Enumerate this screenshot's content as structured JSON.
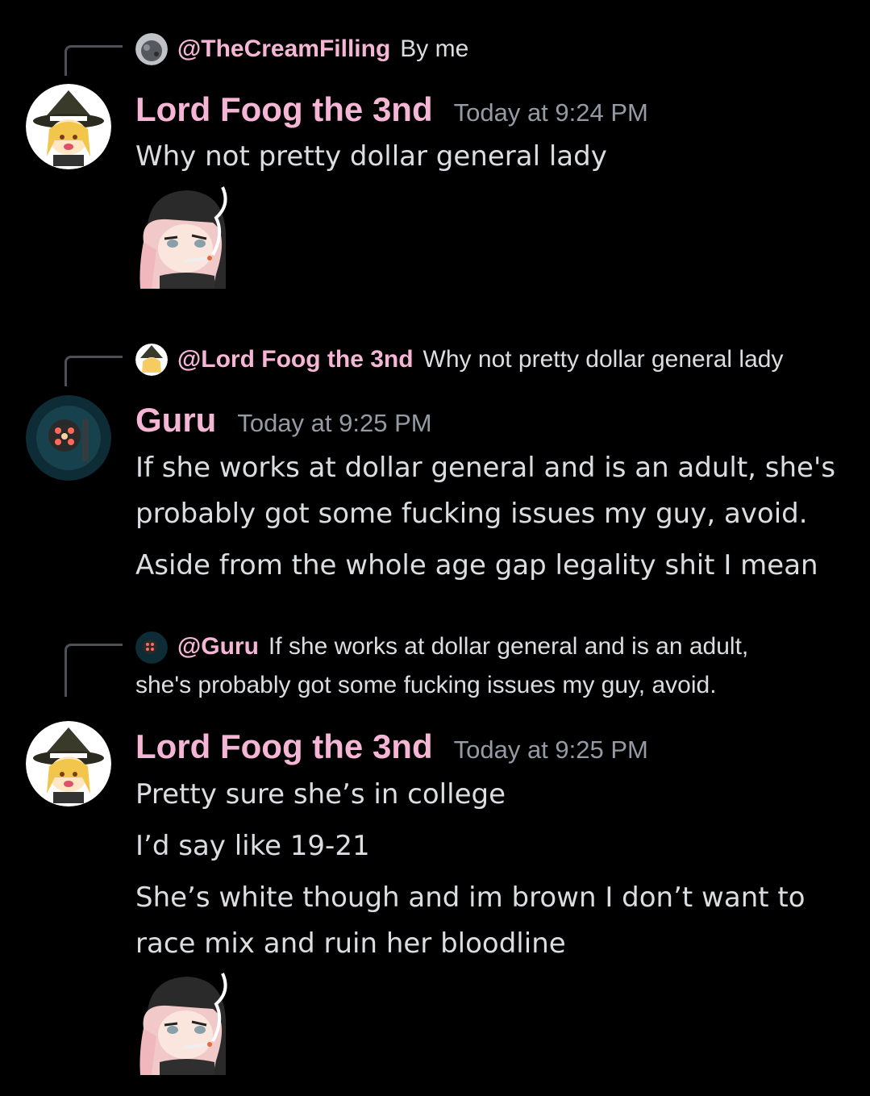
{
  "messages": [
    {
      "reply": {
        "name": "@TheCreamFilling",
        "text": "By me",
        "avatar_icon": "moon-rock-avatar-icon"
      },
      "author": "Lord Foog the 3nd",
      "time": "Today at 9:24 PM",
      "avatar_icon": "witch-girl-avatar-icon",
      "lines": [
        "Why not pretty dollar general lady"
      ],
      "sticker": "smoking-girl-sticker"
    },
    {
      "reply": {
        "name": "@Lord Foog the 3nd",
        "text": "Why not pretty dollar general lady",
        "avatar_icon": "witch-girl-avatar-icon"
      },
      "author": "Guru",
      "time": "Today at 9:25 PM",
      "avatar_icon": "diver-robot-avatar-icon",
      "lines": [
        "If she works at dollar general and is an adult, she's",
        "probably got some fucking issues my guy, avoid.",
        "Aside from the whole age gap legality shit I mean"
      ]
    },
    {
      "reply": {
        "name": "@Guru",
        "text": "If she works at dollar general and is an adult, she's probably got some fucking issues my guy, avoid.",
        "avatar_icon": "diver-robot-avatar-icon"
      },
      "author": "Lord Foog the 3nd",
      "time": "Today at 9:25 PM",
      "avatar_icon": "witch-girl-avatar-icon",
      "lines": [
        "Pretty sure she’s in college",
        "I’d say like 19-21",
        "She’s white though and im brown I don’t want to",
        "race mix and ruin her bloodline"
      ],
      "sticker": "smoking-girl-sticker"
    }
  ],
  "colors": {
    "background": "#000000",
    "name": "#f5b6d6",
    "text": "#dbdee1",
    "time": "#949ba4"
  }
}
